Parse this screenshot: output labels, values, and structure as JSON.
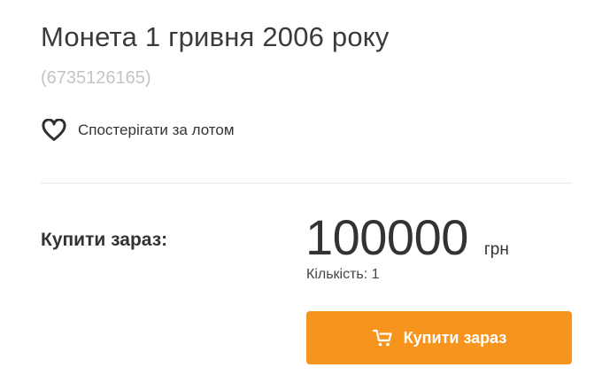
{
  "lot": {
    "title": "Монета 1 гривня 2006 року",
    "id": "(6735126165)"
  },
  "watch": {
    "label": "Спостерігати за лотом",
    "icon": "heart-outline-icon"
  },
  "purchase": {
    "buy_now_label": "Купити зараз:",
    "price": "100000",
    "currency": "грн",
    "quantity": "Кількість: 1",
    "button_label": "Купити зараз",
    "button_icon": "cart-icon",
    "accent_color": "#f7941d"
  }
}
